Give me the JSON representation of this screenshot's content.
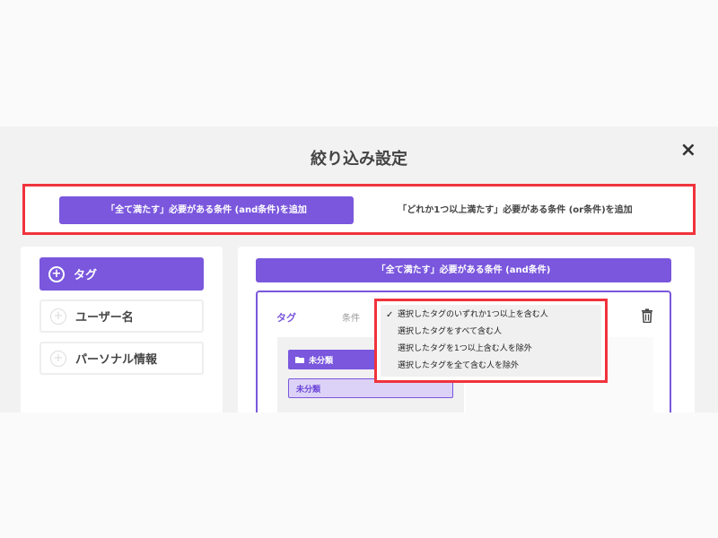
{
  "modal": {
    "title": "絞り込み設定",
    "close_icon": "×"
  },
  "mode_buttons": {
    "and_label": "「全て満たす」必要がある条件 (and条件)を追加",
    "or_label": "「どれか1つ以上満たす」必要がある条件 (or条件)を追加"
  },
  "sidebar": {
    "items": [
      {
        "label": "タグ",
        "icon": "plus-circle-icon"
      },
      {
        "label": "ユーザー名",
        "icon": "plus-circle-icon"
      },
      {
        "label": "パーソナル情報",
        "icon": "plus-circle-icon"
      }
    ]
  },
  "main": {
    "and_header": "「全て満たす」必要がある条件 (and条件)",
    "condition": {
      "tag_label": "タグ",
      "cond_label": "条件",
      "folder_label": "未分類",
      "subitem_label": "未分類"
    },
    "dropdown": {
      "selected_index": 0,
      "check": "✓",
      "options": [
        "選択したタグのいずれか1つ以上を含む人",
        "選択したタグをすべて含む人",
        "選択したタグを1つ以上含む人を除外",
        "選択したタグを全て含む人を除外"
      ]
    }
  },
  "colors": {
    "accent": "#7a57dd",
    "highlight": "#f0333c"
  }
}
